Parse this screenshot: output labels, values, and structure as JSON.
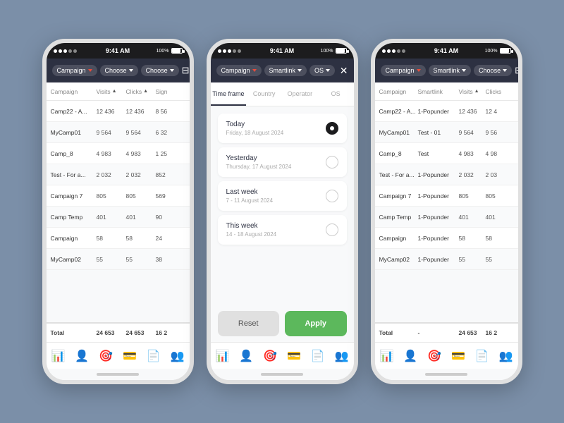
{
  "phones": {
    "statusBar": {
      "time": "9:41 AM",
      "battery": "100%"
    },
    "phone1": {
      "header": {
        "campaign_label": "Campaign",
        "choose1_label": "Choose",
        "choose2_label": "Choose"
      },
      "table": {
        "columns": [
          "Campaign",
          "Visits",
          "Clicks",
          "Sign"
        ],
        "rows": [
          [
            "Camp22 - A...",
            "12 436",
            "12 436",
            "8 56"
          ],
          [
            "MyCamp01",
            "9 564",
            "9 564",
            "6 32"
          ],
          [
            "Camp_8",
            "4 983",
            "4 983",
            "1 25"
          ],
          [
            "Test - For a...",
            "2 032",
            "2 032",
            "852"
          ],
          [
            "Campaign 7",
            "805",
            "805",
            "569"
          ],
          [
            "Camp Temp",
            "401",
            "401",
            "90"
          ],
          [
            "Campaign",
            "58",
            "58",
            "24"
          ],
          [
            "MyCamp02",
            "55",
            "55",
            "38"
          ]
        ],
        "footer": [
          "Total",
          "24 653",
          "24 653",
          "16 2"
        ]
      },
      "nav_icons": [
        "📊",
        "👤",
        "🎯",
        "💳",
        "📄",
        "👥"
      ]
    },
    "phone2": {
      "header": {
        "campaign_label": "Campaign",
        "smartlink_label": "Smartlink",
        "os_label": "OS"
      },
      "filter": {
        "tabs": [
          "Time frame",
          "Country",
          "Operator",
          "OS"
        ],
        "active_tab": "Time frame",
        "options": [
          {
            "title": "Today",
            "subtitle": "Friday, 18 August 2024",
            "selected": true
          },
          {
            "title": "Yesterday",
            "subtitle": "Thursday, 17 August 2024",
            "selected": false
          },
          {
            "title": "Last week",
            "subtitle": "7 - 11 August 2024",
            "selected": false
          },
          {
            "title": "This week",
            "subtitle": "14 - 18 August 2024",
            "selected": false
          }
        ],
        "reset_label": "Reset",
        "apply_label": "Apply"
      }
    },
    "phone3": {
      "header": {
        "campaign_label": "Campaign",
        "smartlink_label": "Smartlink",
        "choose_label": "Choose"
      },
      "table": {
        "columns": [
          "Campaign",
          "Smartlink",
          "Visits",
          "Clicks"
        ],
        "rows": [
          [
            "Camp22 - A...",
            "1-Popunder",
            "12 436",
            "12 4"
          ],
          [
            "MyCamp01",
            "Test - 01",
            "9 564",
            "9 56"
          ],
          [
            "Camp_8",
            "Test",
            "4 983",
            "4 98"
          ],
          [
            "Test - For a...",
            "1-Popunder",
            "2 032",
            "2 03"
          ],
          [
            "Campaign 7",
            "1-Popunder",
            "805",
            "805"
          ],
          [
            "Camp Temp",
            "1-Popunder",
            "401",
            "401"
          ],
          [
            "Campaign",
            "1-Popunder",
            "58",
            "58"
          ],
          [
            "MyCamp02",
            "1-Popunder",
            "55",
            "55"
          ]
        ],
        "footer": [
          "Total",
          "-",
          "24 653",
          "16 2"
        ]
      }
    }
  }
}
